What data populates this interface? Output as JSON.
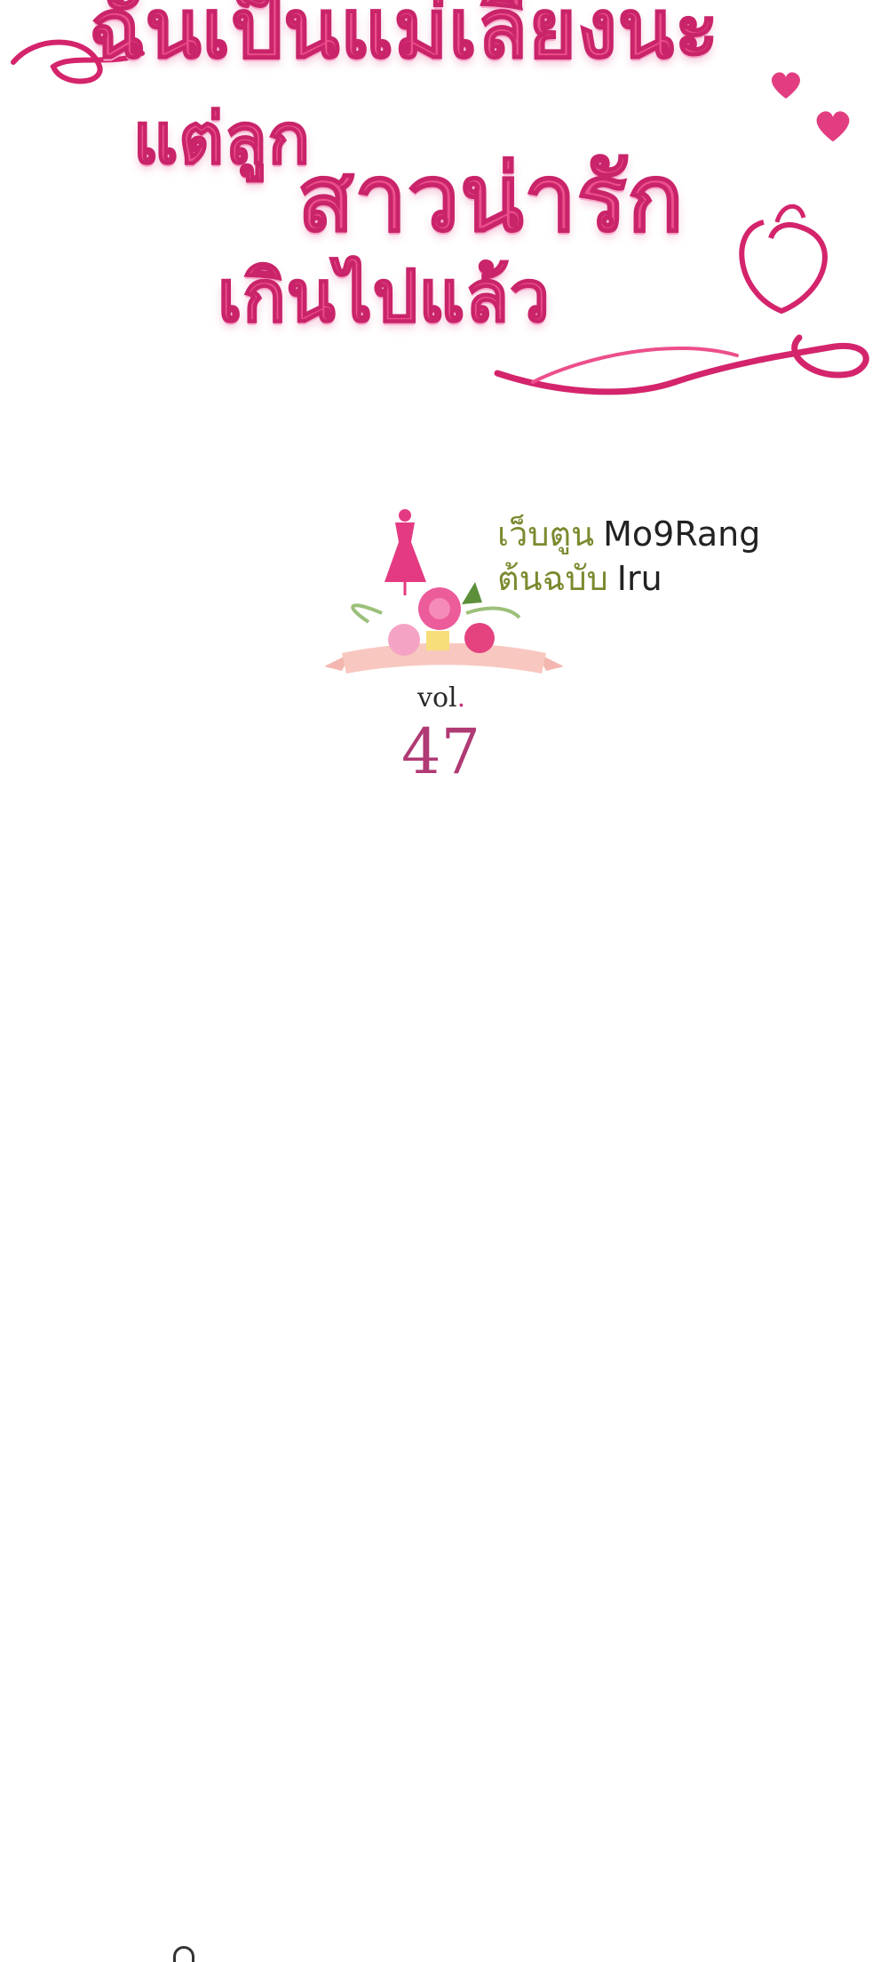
{
  "title": {
    "line1": "ฉันเป็นแม่เลี้ยงนะ",
    "line2a": "แต่ลูก",
    "line2b": "สาวน่ารัก",
    "line3": "เกินไปแล้ว"
  },
  "credits": {
    "webtoon_label": "เว็บตูน",
    "webtoon_value": "Mo9Rang",
    "original_label": "ต้นฉบับ",
    "original_value": "Iru"
  },
  "volume": {
    "label": "vol",
    "dot": ".",
    "number": "47"
  },
  "colors": {
    "title_pink": "#ec4f8c",
    "ribbon_magenta": "#d4246c",
    "credit_label_green": "#7a8a2e",
    "volume_pink": "#b03a74"
  }
}
